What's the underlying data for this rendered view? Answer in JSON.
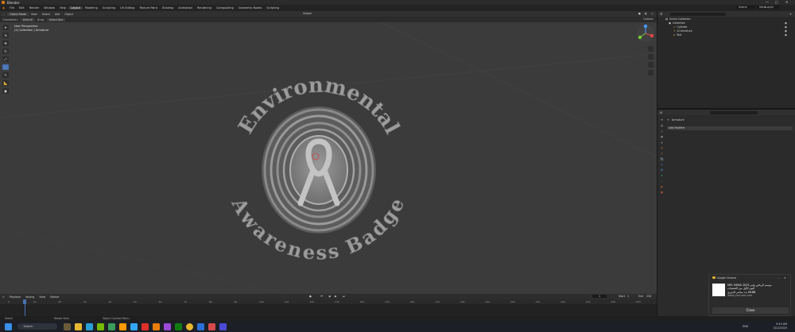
{
  "app": {
    "title": "Blender"
  },
  "menu": {
    "items": [
      "File",
      "Edit",
      "Render",
      "Window",
      "Help"
    ],
    "workspaces": [
      "Layout",
      "Modeling",
      "Sculpting",
      "UV Editing",
      "Texture Paint",
      "Shading",
      "Animation",
      "Rendering",
      "Compositing",
      "Geometry Nodes",
      "Scripting"
    ],
    "active_workspace": "Layout",
    "scene": "Scene",
    "view_layer": "ViewLayer"
  },
  "viewport_header": {
    "mode": "Object Mode",
    "items": [
      "View",
      "Select",
      "Add",
      "Object"
    ],
    "transform": "Global",
    "options": "Options"
  },
  "tool_header": {
    "orientation_label": "Orientation:",
    "orientation": "Default",
    "drag_label": "Drag:",
    "drag": "Select Box"
  },
  "viewport_info": {
    "line1": "User Perspective",
    "line2": "(1) Collection | Armature"
  },
  "badge": {
    "top_text": "Environmental",
    "bottom_text": "Awareness Badge"
  },
  "outliner": {
    "root": "Scene Collection",
    "collection": "Collection",
    "items": [
      "Cylinder",
      "Ai Armature",
      "Text"
    ]
  },
  "properties": {
    "object_name": "Armature",
    "section": "Add Modifier"
  },
  "timeline": {
    "menus": [
      "Playback",
      "Keying",
      "View",
      "Marker"
    ],
    "current_frame": "1",
    "start_label": "Start",
    "start": "1",
    "end_label": "End",
    "end": "250",
    "ticks": [
      "0",
      "10",
      "20",
      "30",
      "40",
      "50",
      "60",
      "70",
      "80",
      "90",
      "100",
      "110",
      "120",
      "130",
      "140",
      "150",
      "160",
      "170",
      "180",
      "190",
      "200",
      "210",
      "220",
      "230",
      "240",
      "250"
    ]
  },
  "status": {
    "items": [
      "Select",
      "Rotate View",
      "Object Context Menu"
    ]
  },
  "taskbar": {
    "search": "Search",
    "time": "9:43 AM",
    "date": "3/12/2025",
    "lang": "ENG"
  },
  "notification": {
    "app": "Google Chrome",
    "title": "موسم الرياض وايبر MPL MENA 2025",
    "line2": "اليوم الأول من التصفيات",
    "line3": "MLBB بث مباشر للدوري",
    "source": "www.youtube.com",
    "close": "Close"
  }
}
